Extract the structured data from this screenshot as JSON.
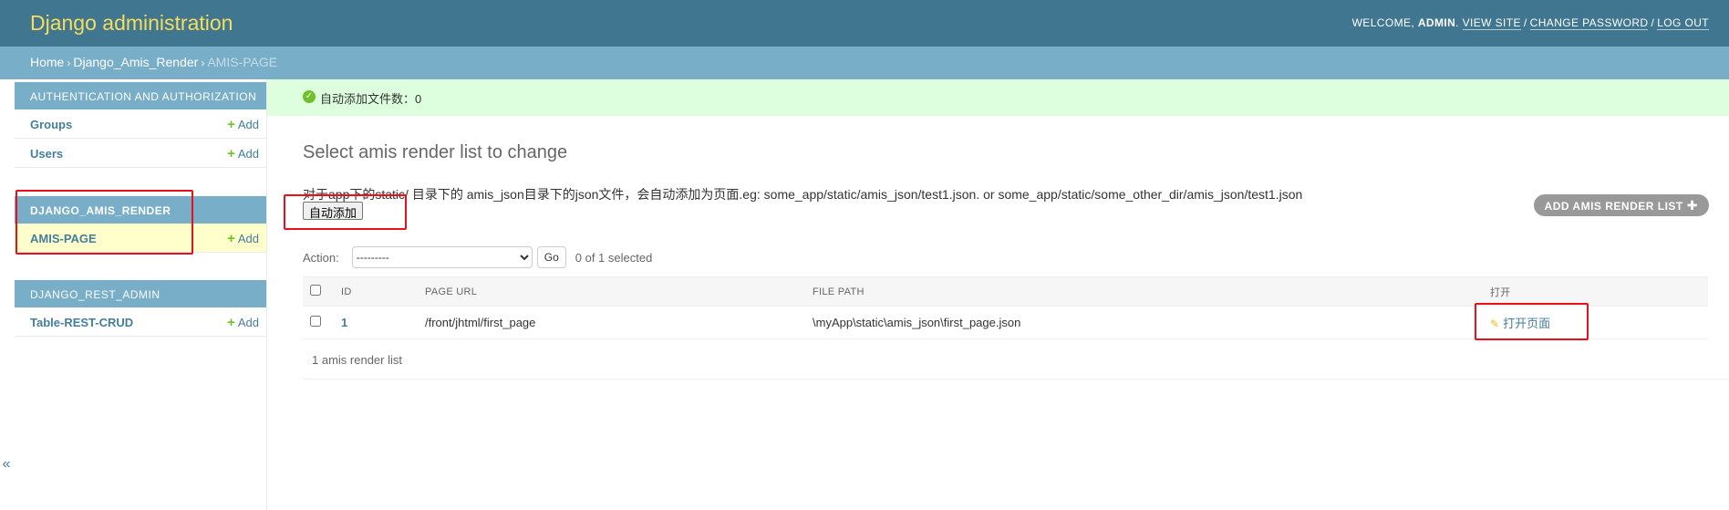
{
  "header": {
    "branding": "Django administration",
    "welcome": "Welcome,",
    "user": "admin",
    "view_site": "View site",
    "change_password": "Change password",
    "log_out": "Log out"
  },
  "breadcrumbs": {
    "home": "Home",
    "app": "Django_Amis_Render",
    "current": "AMIS-PAGE"
  },
  "sidebar": {
    "add_label": "Add",
    "toggle": "«",
    "modules": [
      {
        "caption": "Authentication and Authorization",
        "models": [
          "Groups",
          "Users"
        ]
      },
      {
        "caption": "DJANGO_AMIS_RENDER",
        "models": [
          "AMIS-PAGE"
        ]
      },
      {
        "caption": "DJANGO_REST_ADMIN",
        "models": [
          "Table-REST-CRUD"
        ]
      }
    ]
  },
  "messages": {
    "success": "自动添加文件数：0"
  },
  "content": {
    "title": "Select amis render list to change",
    "intro": "对于app下的static/ 目录下的 amis_json目录下的json文件，会自动添加为页面.eg: some_app/static/amis_json/test1.json. or some_app/static/some_other_dir/amis_json/test1.json",
    "auto_add_button": "自动添加",
    "add_button": "Add amis render list"
  },
  "actions": {
    "label": "Action:",
    "selected_option": "---------",
    "go": "Go",
    "selected_count": "0 of 1 selected"
  },
  "table": {
    "columns": [
      "ID",
      "Page URL",
      "File path",
      "打开"
    ],
    "rows": [
      {
        "id": "1",
        "page_url": "/front/jhtml/first_page",
        "file_path": "\\myApp\\static\\amis_json\\first_page.json",
        "open": "打开页面"
      }
    ]
  },
  "paginator": "1 amis render list",
  "colors": {
    "header_bg": "#417690",
    "breadcrumbs_bg": "#79aec8",
    "branding": "#f5dd5d",
    "link": "#447e9b",
    "success_bg": "#dddddd",
    "annotation_red": "#e8101a"
  }
}
